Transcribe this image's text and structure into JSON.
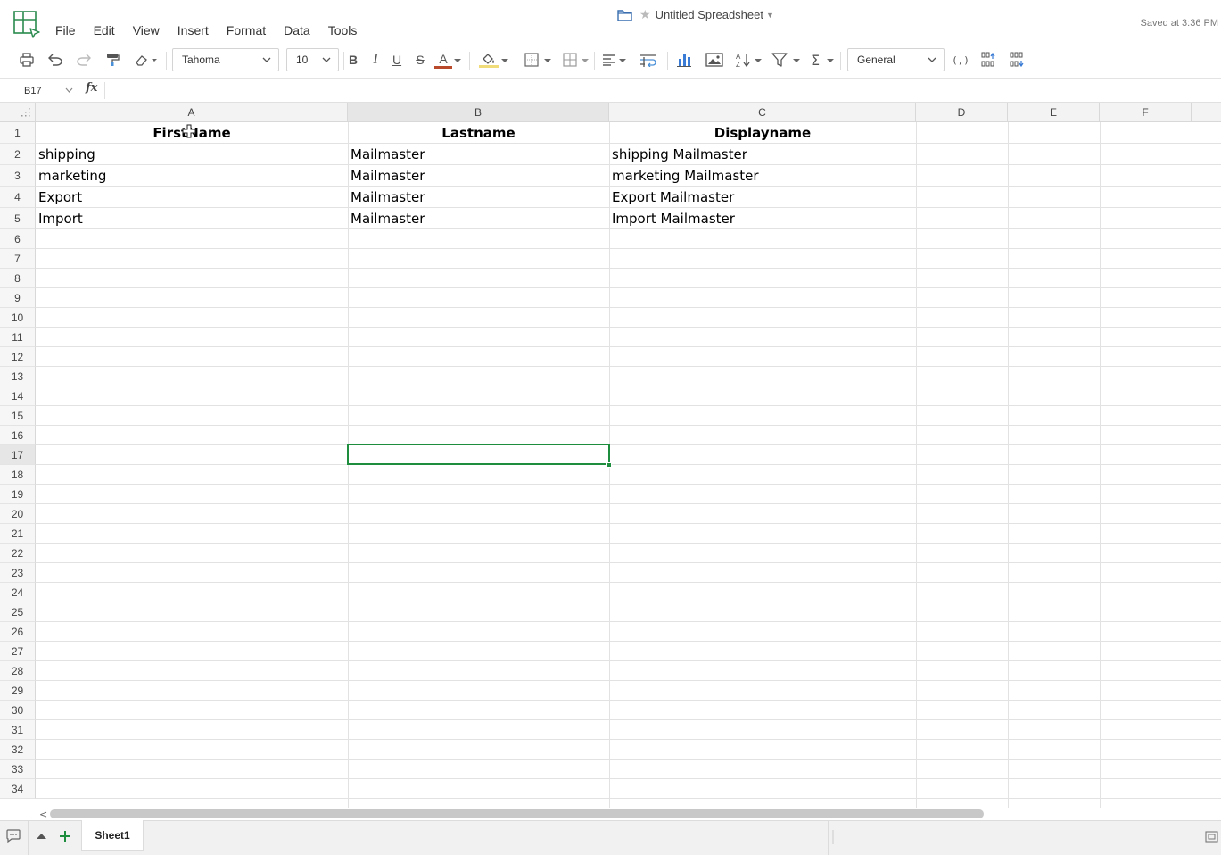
{
  "app": {
    "menus": [
      "File",
      "Edit",
      "View",
      "Insert",
      "Format",
      "Data",
      "Tools"
    ],
    "document_title": "Untitled Spreadsheet",
    "saved_status": "Saved at 3:36 PM",
    "accent_color": "#1e8e3e"
  },
  "toolbar": {
    "font_family": "Tahoma",
    "font_size": "10",
    "number_format": "General",
    "bold_label": "B",
    "italic_label": "I",
    "underline_label": "U",
    "strike_label": "S",
    "text_color_label": "A",
    "sum_label": "Σ",
    "icons": [
      "print-icon",
      "undo-icon",
      "redo-icon",
      "paint-format-icon",
      "clear-format-icon",
      "bold-icon",
      "italic-icon",
      "underline-icon",
      "strikethrough-icon",
      "text-color-icon",
      "fill-color-icon",
      "borders-icon",
      "merge-icon",
      "align-icon",
      "wrap-icon",
      "chart-icon",
      "image-icon",
      "sort-icon",
      "filter-icon",
      "sum-icon",
      "decimal-icon",
      "increase-decimal-icon",
      "decrease-decimal-icon"
    ]
  },
  "formula_bar": {
    "cell_ref": "B17",
    "fx_label": "fx",
    "formula": ""
  },
  "grid": {
    "columns": [
      "A",
      "B",
      "C",
      "D",
      "E",
      "F"
    ],
    "row_count": 34,
    "selected_cell": "B17",
    "rows": [
      [
        "FirstName",
        "Lastname",
        "Displayname"
      ],
      [
        "shipping",
        "Mailmaster",
        "shipping Mailmaster"
      ],
      [
        "marketing",
        "Mailmaster",
        "marketing Mailmaster"
      ],
      [
        "Export",
        "Mailmaster",
        "Export Mailmaster"
      ],
      [
        "Import",
        "Mailmaster",
        "Import Mailmaster"
      ]
    ]
  },
  "sheets": {
    "tabs": [
      "Sheet1"
    ],
    "active": "Sheet1"
  }
}
